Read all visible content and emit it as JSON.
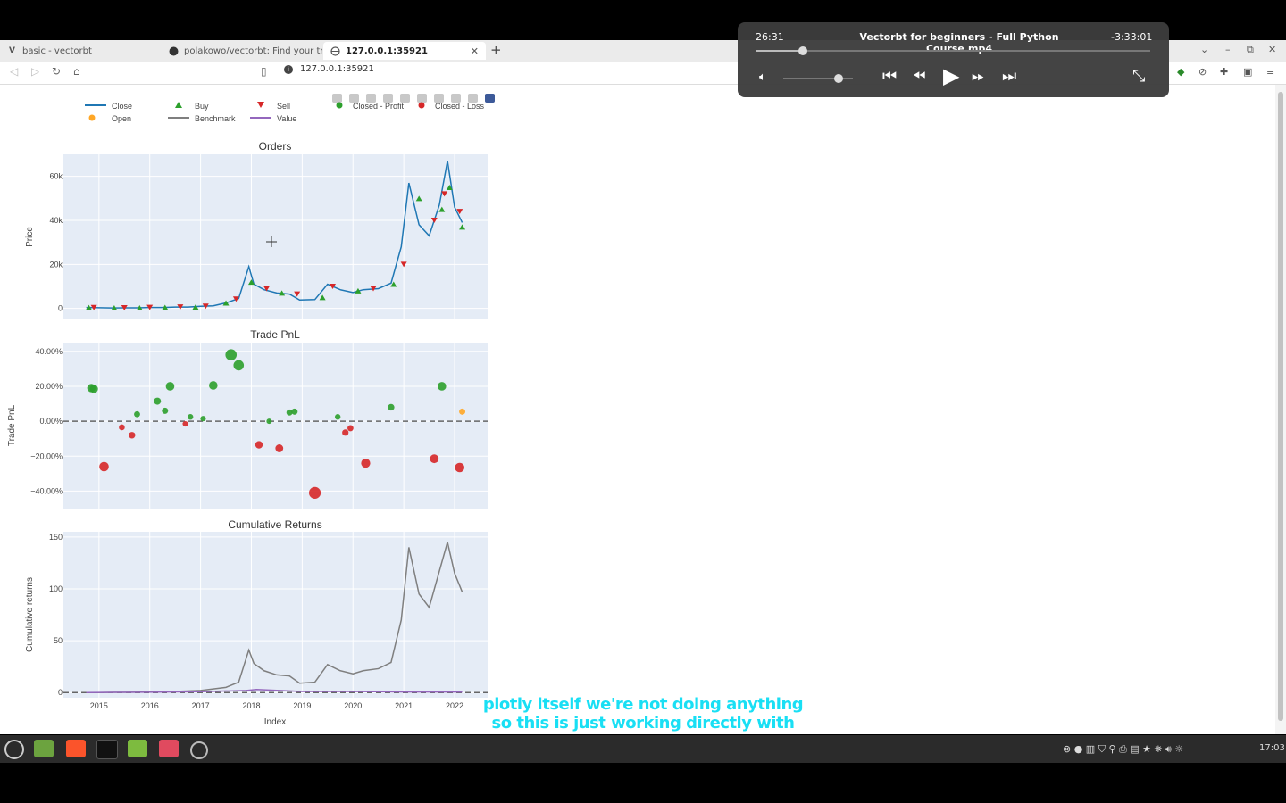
{
  "browser": {
    "tabs": [
      {
        "title": "basic - vectorbt",
        "icon": "V"
      },
      {
        "title": "polakowo/vectorbt: Find your trad",
        "icon": "github"
      },
      {
        "title": "127.0.0.1:35921",
        "icon": "globe"
      }
    ],
    "url": "127.0.0.1:35921"
  },
  "player": {
    "elapsed": "26:31",
    "title": "Vectorbt for beginners - Full Python Course.mp4",
    "remaining": "-3:33:01",
    "progress_pct": 12
  },
  "subtitle": {
    "line1": "plotly itself we're not doing anything",
    "line2": "so this is just working directly with"
  },
  "taskbar": {
    "clock": "17:03"
  },
  "legend": {
    "close": "Close",
    "open": "Open",
    "buy": "Buy",
    "benchmark": "Benchmark",
    "sell": "Sell",
    "value": "Value",
    "closed_profit": "Closed - Profit",
    "closed_loss": "Closed - Loss"
  },
  "colors": {
    "close": "#1f77b4",
    "open": "#ffa726",
    "buy": "#2ca02c",
    "sell": "#d62728",
    "benchmark": "#7f7f7f",
    "value": "#9467bd",
    "profit": "#2ca02c",
    "loss": "#d62728",
    "plot_bg": "#e5ecf6"
  },
  "chart_data": [
    {
      "type": "line",
      "title": "Orders",
      "ylabel": "Price",
      "ylim": [
        -5000,
        70000
      ],
      "yticks": [
        "0",
        "20k",
        "40k",
        "60k"
      ],
      "ytick_values": [
        0,
        20000,
        40000,
        60000
      ],
      "x": [
        2014.75,
        2015.0,
        2015.25,
        2015.5,
        2015.75,
        2016.0,
        2016.25,
        2016.5,
        2016.75,
        2017.0,
        2017.25,
        2017.5,
        2017.75,
        2017.95,
        2018.05,
        2018.25,
        2018.5,
        2018.75,
        2018.95,
        2019.25,
        2019.5,
        2019.75,
        2020.0,
        2020.2,
        2020.5,
        2020.75,
        2020.95,
        2021.1,
        2021.3,
        2021.5,
        2021.7,
        2021.86,
        2022.0,
        2022.15
      ],
      "values": [
        400,
        300,
        240,
        270,
        260,
        400,
        420,
        650,
        620,
        1000,
        1200,
        2500,
        4500,
        19000,
        11000,
        8500,
        7000,
        6500,
        3800,
        4000,
        11000,
        8500,
        7200,
        8500,
        9000,
        11500,
        28000,
        57000,
        38000,
        33000,
        47000,
        67000,
        46000,
        39000
      ],
      "buys_x": [
        2014.8,
        2015.3,
        2015.8,
        2016.3,
        2016.9,
        2017.5,
        2018.0,
        2018.6,
        2019.4,
        2020.1,
        2020.8,
        2021.3,
        2021.75,
        2021.9,
        2022.15
      ],
      "buys_y": [
        400,
        250,
        260,
        450,
        650,
        2500,
        12000,
        7000,
        5000,
        8000,
        11000,
        50000,
        45000,
        55000,
        37000
      ],
      "sells_x": [
        2014.9,
        2015.5,
        2016.0,
        2016.6,
        2017.1,
        2017.7,
        2018.3,
        2018.9,
        2019.6,
        2020.4,
        2021.0,
        2021.6,
        2021.8,
        2022.1
      ],
      "sells_y": [
        350,
        270,
        400,
        600,
        1000,
        4200,
        9000,
        6500,
        10000,
        9000,
        20000,
        40000,
        52000,
        44000
      ]
    },
    {
      "type": "scatter",
      "title": "Trade PnL",
      "ylabel": "Trade PnL",
      "ylim": [
        -50,
        45
      ],
      "yticks": [
        "40.00%",
        "20.00%",
        "0.00%",
        "−20.00%",
        "−40.00%"
      ],
      "ytick_values": [
        40,
        20,
        0,
        -20,
        -40
      ],
      "x": [
        2014.85,
        2014.9,
        2015.1,
        2015.45,
        2015.65,
        2015.75,
        2016.15,
        2016.3,
        2016.4,
        2016.7,
        2016.8,
        2017.05,
        2017.25,
        2017.6,
        2017.75,
        2018.15,
        2018.35,
        2018.55,
        2018.75,
        2018.85,
        2019.25,
        2019.7,
        2019.85,
        2019.95,
        2020.25,
        2020.75,
        2021.6,
        2021.75,
        2022.1,
        2022.15
      ],
      "values": [
        19,
        18.5,
        -26,
        -3.5,
        -8,
        4,
        11.5,
        6,
        20,
        -1.5,
        2.5,
        1.5,
        20.5,
        38,
        32,
        -13.5,
        0,
        -15.5,
        5,
        5.5,
        -41,
        2.5,
        -6.5,
        -4,
        -24,
        8,
        -21.5,
        20,
        -26.5,
        5.5
      ],
      "result": [
        "p",
        "p",
        "l",
        "l",
        "l",
        "p",
        "p",
        "p",
        "p",
        "l",
        "p",
        "p",
        "p",
        "p",
        "p",
        "l",
        "p",
        "l",
        "p",
        "p",
        "l",
        "p",
        "l",
        "l",
        "l",
        "p",
        "l",
        "p",
        "l",
        "o"
      ]
    },
    {
      "type": "line",
      "title": "Cumulative Returns",
      "xlabel": "Index",
      "ylabel": "Cumulative returns",
      "ylim": [
        -5,
        155
      ],
      "yticks": [
        "0",
        "50",
        "100",
        "150"
      ],
      "ytick_values": [
        0,
        50,
        100,
        150
      ],
      "xticks": [
        "2015",
        "2016",
        "2017",
        "2018",
        "2019",
        "2020",
        "2021",
        "2022"
      ],
      "xtick_values": [
        2015,
        2016,
        2017,
        2018,
        2019,
        2020,
        2021,
        2022
      ],
      "xlim": [
        2014.3,
        2022.65
      ],
      "series": [
        {
          "name": "Benchmark",
          "x": [
            2014.75,
            2015.0,
            2015.5,
            2016.0,
            2016.5,
            2017.0,
            2017.5,
            2017.75,
            2017.95,
            2018.05,
            2018.25,
            2018.5,
            2018.75,
            2018.95,
            2019.25,
            2019.5,
            2019.75,
            2020.0,
            2020.2,
            2020.5,
            2020.75,
            2020.95,
            2021.1,
            2021.3,
            2021.5,
            2021.7,
            2021.86,
            2022.0,
            2022.15
          ],
          "values": [
            0,
            0,
            0.2,
            0.5,
            1,
            2,
            5,
            10,
            41,
            28,
            21,
            17,
            16,
            9,
            10,
            27,
            21,
            18,
            21,
            23,
            29,
            70,
            140,
            95,
            82,
            117,
            145,
            115,
            97
          ]
        },
        {
          "name": "Value",
          "x": [
            2014.75,
            2016.0,
            2017.0,
            2017.9,
            2018.1,
            2019.0,
            2020.0,
            2021.0,
            2022.15
          ],
          "values": [
            0,
            0.3,
            0.8,
            2,
            3,
            1,
            1,
            0.5,
            0.5
          ]
        }
      ]
    }
  ]
}
